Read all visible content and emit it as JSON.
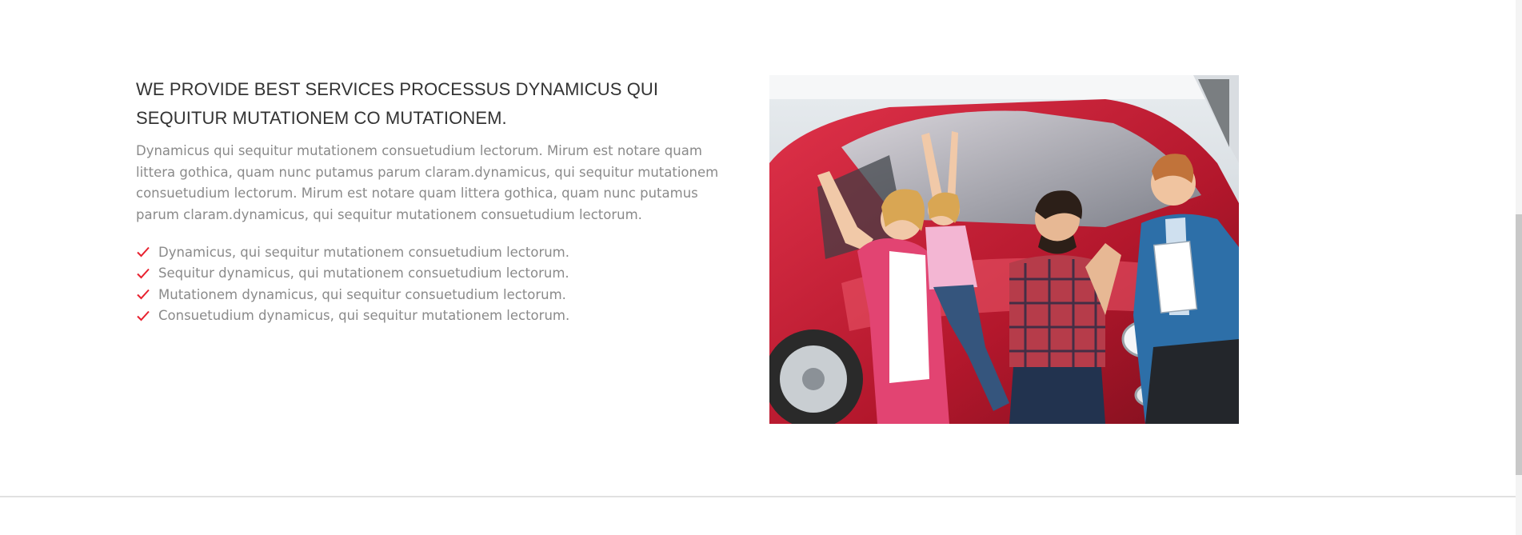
{
  "section": {
    "headline": "WE PROVIDE BEST SERVICES PROCESSUS DYNAMICUS QUI SEQUITUR MUTATIONEM CO MUTATIONEM.",
    "description": "Dynamicus qui sequitur mutationem consuetudium lectorum. Mirum est notare quam littera gothica, quam nunc putamus parum claram.dynamicus, qui sequitur mutationem consuetudium lectorum. Mirum est notare quam littera gothica, quam nunc putamus parum claram.dynamicus, qui sequitur mutationem consuetudium lectorum.",
    "checklist": [
      "Dynamicus, qui sequitur mutationem consuetudium lectorum.",
      "Sequitur dynamicus, qui mutationem consuetudium lectorum.",
      "Mutationem dynamicus, qui sequitur consuetudium lectorum.",
      "Consuetudium dynamicus, qui sequitur mutationem lectorum."
    ],
    "check_icon": "checkmark-icon",
    "photo_alt": "family-celebrating-new-car-photo"
  },
  "colors": {
    "accent": "#e8212f",
    "headline": "#333333",
    "body_text": "#8a8a8a",
    "divider": "#e1e1e1"
  }
}
